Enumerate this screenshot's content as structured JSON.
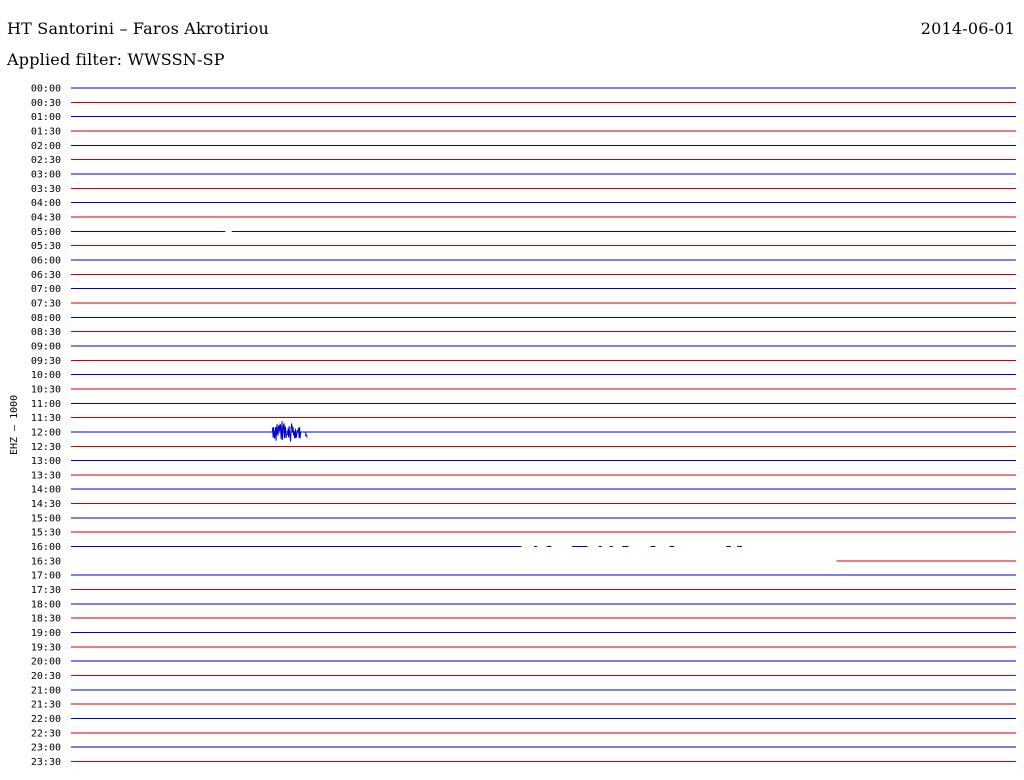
{
  "header": {
    "title": "HT Santorini – Faros Akrotiriou",
    "date": "2014-06-01",
    "filter_label": "Applied filter: WWSSN-SP"
  },
  "chart_data": {
    "type": "line",
    "title": "HT Santorini – Faros Akrotiriou",
    "ylabel": "EHZ – 1000",
    "xlabel": "",
    "y_ticks": [
      "00:00",
      "00:30",
      "01:00",
      "01:30",
      "02:00",
      "02:30",
      "03:00",
      "03:30",
      "04:00",
      "04:30",
      "05:00",
      "05:30",
      "06:00",
      "06:30",
      "07:00",
      "07:30",
      "08:00",
      "08:30",
      "09:00",
      "09:30",
      "10:00",
      "10:30",
      "11:00",
      "11:30",
      "12:00",
      "12:30",
      "13:00",
      "13:30",
      "14:00",
      "14:30",
      "15:00",
      "15:30",
      "16:00",
      "16:30",
      "17:00",
      "17:30",
      "18:00",
      "18:30",
      "19:00",
      "19:30",
      "20:00",
      "20:30",
      "21:00",
      "21:30",
      "22:00",
      "22:30",
      "23:00",
      "23:30"
    ],
    "x_range_minutes": [
      0,
      30
    ],
    "trace_colors": {
      "hour": "#0000cc",
      "half_hour": "#cc0000"
    },
    "trace_start_minute": [
      0,
      0,
      0,
      0,
      0,
      0,
      0,
      0,
      0,
      0,
      0,
      0,
      0,
      0,
      0,
      0,
      0,
      0,
      0,
      0,
      0,
      0,
      0,
      0,
      0,
      0,
      0,
      0,
      0,
      0,
      0,
      0,
      0,
      24.3,
      0,
      0,
      0,
      0,
      0,
      0,
      0,
      0,
      0,
      0,
      0,
      0,
      0,
      0
    ],
    "trace_end_minute": [
      30,
      30,
      30,
      30,
      30,
      30,
      30,
      30,
      30,
      30,
      30,
      30,
      30,
      30,
      30,
      30,
      30,
      30,
      30,
      30,
      30,
      30,
      30,
      30,
      30,
      30,
      30,
      30,
      30,
      30,
      30,
      30,
      30,
      30,
      30,
      30,
      30,
      30,
      30,
      30,
      30,
      30,
      30,
      30,
      30,
      30,
      30,
      30
    ],
    "gaps": [
      {
        "row": 10,
        "from_min": 4.9,
        "to_min": 5.1
      },
      {
        "row": 32,
        "from_min": 14.3,
        "to_min": 14.7
      },
      {
        "row": 32,
        "from_min": 14.8,
        "to_min": 15.1
      },
      {
        "row": 32,
        "from_min": 15.25,
        "to_min": 15.9
      },
      {
        "row": 32,
        "from_min": 16.4,
        "to_min": 16.75
      },
      {
        "row": 32,
        "from_min": 16.85,
        "to_min": 17.1
      },
      {
        "row": 32,
        "from_min": 17.2,
        "to_min": 17.5
      },
      {
        "row": 32,
        "from_min": 17.7,
        "to_min": 18.4
      },
      {
        "row": 32,
        "from_min": 18.55,
        "to_min": 19.0
      },
      {
        "row": 32,
        "from_min": 19.15,
        "to_min": 20.8
      },
      {
        "row": 32,
        "from_min": 20.95,
        "to_min": 21.15
      },
      {
        "row": 32,
        "from_min": 21.3,
        "to_min": 30
      }
    ],
    "events": [
      {
        "row": 24,
        "start_min": 6.4,
        "end_min": 7.3,
        "amplitude": 12
      },
      {
        "row": 24,
        "start_min": 7.45,
        "end_min": 7.5,
        "amplitude": 12
      }
    ],
    "grid": false
  }
}
